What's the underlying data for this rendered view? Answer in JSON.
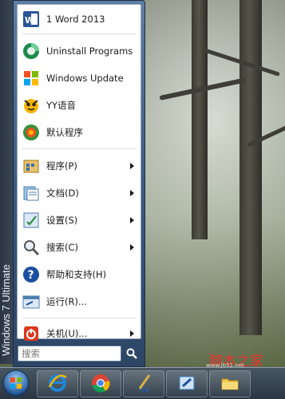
{
  "system": {
    "edition_label": "Windows 7 Ultimate"
  },
  "start_menu": {
    "pinned_items": [
      {
        "label": "1 Word 2013",
        "icon": "word-icon"
      },
      {
        "label": "Uninstall Programs",
        "icon": "uninstall-icon"
      },
      {
        "label": "Windows Update",
        "icon": "windows-update-icon"
      },
      {
        "label": "YY语音",
        "icon": "yy-voice-icon"
      },
      {
        "label": "默认程序",
        "icon": "default-programs-icon"
      }
    ],
    "system_items": [
      {
        "label": "程序(P)",
        "icon": "programs-icon",
        "submenu": true
      },
      {
        "label": "文档(D)",
        "icon": "documents-icon",
        "submenu": true
      },
      {
        "label": "设置(S)",
        "icon": "settings-icon",
        "submenu": true
      },
      {
        "label": "搜索(C)",
        "icon": "search-magnifier-icon",
        "submenu": true
      },
      {
        "label": "帮助和支持(H)",
        "icon": "help-icon",
        "submenu": false
      },
      {
        "label": "运行(R)...",
        "icon": "run-icon",
        "submenu": false
      }
    ],
    "shutdown": {
      "label": "关机(U)...",
      "icon": "power-icon",
      "submenu": true
    },
    "search": {
      "placeholder": "搜索"
    }
  },
  "taskbar": {
    "buttons": [
      {
        "name": "internet-explorer",
        "icon": "internet-explorer-icon"
      },
      {
        "name": "chrome",
        "icon": "chrome-icon"
      },
      {
        "name": "photoshop-cs",
        "icon": "ps-cs-icon"
      },
      {
        "name": "paint",
        "icon": "paint-icon"
      },
      {
        "name": "file-explorer",
        "icon": "folder-icon"
      }
    ]
  },
  "watermark": {
    "title": "脚本之家",
    "url": "www.jb51.net"
  }
}
